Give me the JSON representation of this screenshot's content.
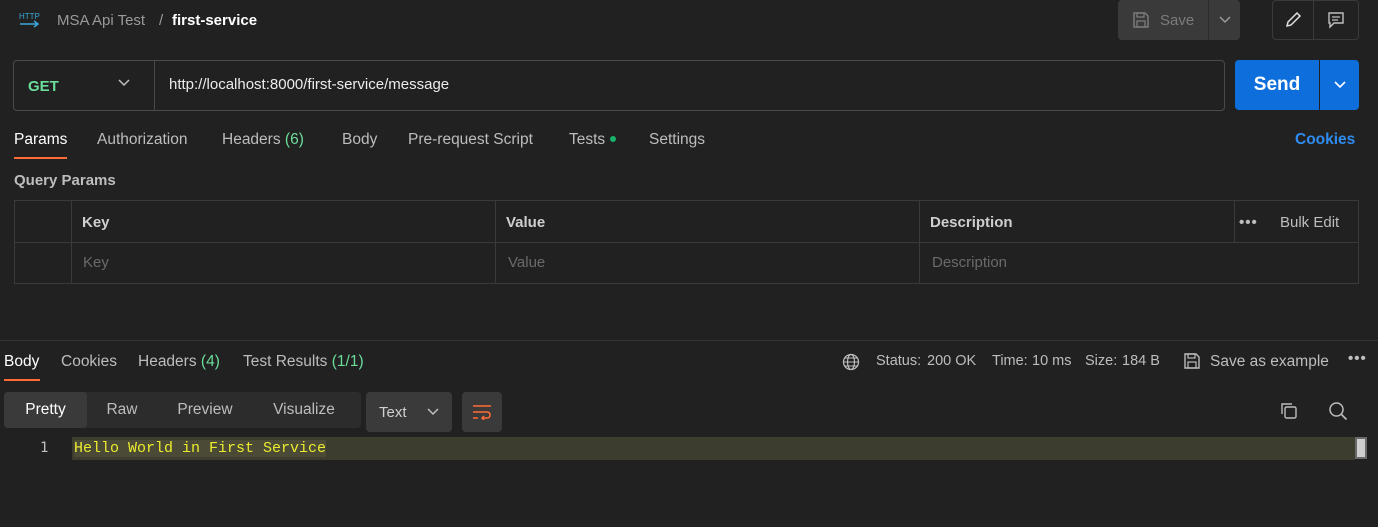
{
  "header": {
    "collection": "MSA Api Test",
    "separator": "/",
    "request_name": "first-service",
    "save_label": "Save"
  },
  "request": {
    "method": "GET",
    "url": "http://localhost:8000/first-service/message",
    "send_label": "Send"
  },
  "request_tabs": {
    "params": "Params",
    "authorization": "Authorization",
    "headers": "Headers",
    "headers_count": "(6)",
    "body": "Body",
    "pre_request": "Pre-request Script",
    "tests": "Tests",
    "settings": "Settings",
    "cookies": "Cookies"
  },
  "query_params": {
    "title": "Query Params",
    "columns": {
      "key": "Key",
      "value": "Value",
      "description": "Description"
    },
    "bulk_edit": "Bulk Edit",
    "more": "•••",
    "placeholders": {
      "key": "Key",
      "value": "Value",
      "description": "Description"
    }
  },
  "response_tabs": {
    "body": "Body",
    "cookies": "Cookies",
    "headers": "Headers",
    "headers_count": "(4)",
    "test_results": "Test Results",
    "test_results_count": "(1/1)"
  },
  "response_meta": {
    "status_label": "Status:",
    "status_value": "200 OK",
    "time_label": "Time:",
    "time_value": "10 ms",
    "size_label": "Size:",
    "size_value": "184 B",
    "save_example": "Save as example",
    "more": "•••"
  },
  "view": {
    "modes": [
      "Pretty",
      "Raw",
      "Preview",
      "Visualize"
    ],
    "format": "Text"
  },
  "response_body": {
    "line_number": "1",
    "line_text": "Hello World in First Service"
  },
  "colors": {
    "accent": "#ff6c37",
    "send": "#0e6fdc",
    "method_get": "#6bdd9a",
    "link": "#2e8cf0",
    "code_text": "#ecec2e"
  }
}
